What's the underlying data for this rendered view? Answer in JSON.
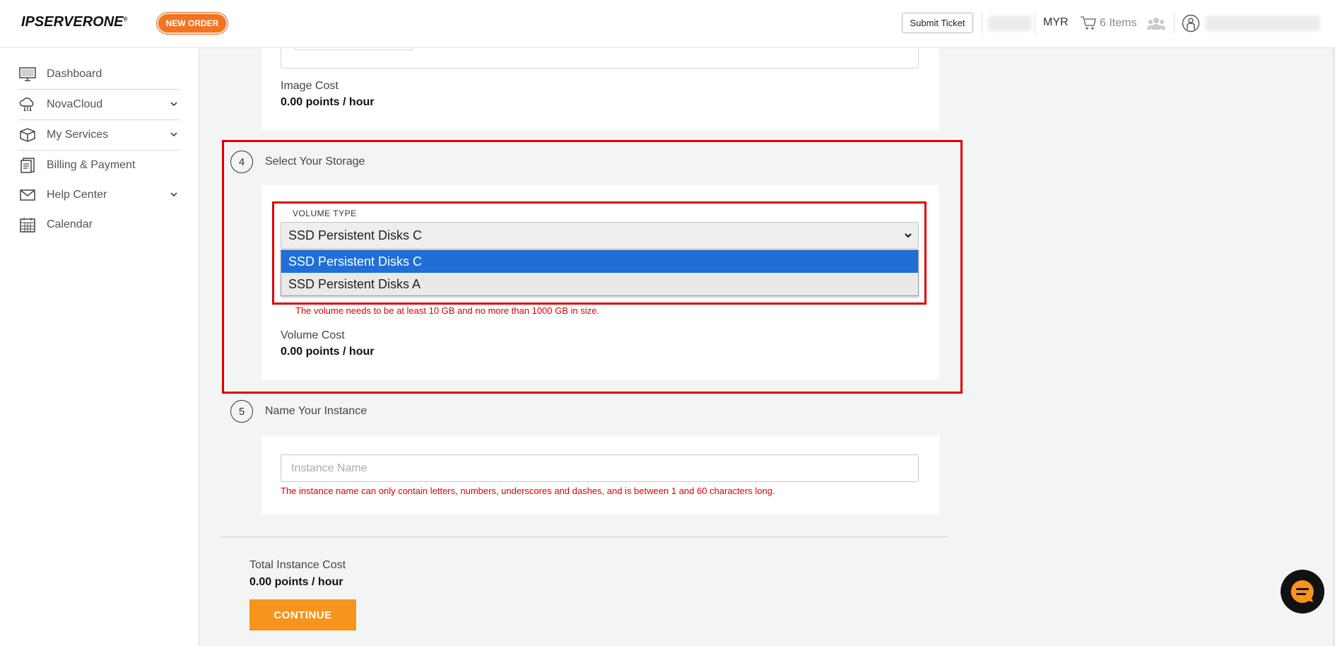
{
  "header": {
    "logo": "IPSERVERONE",
    "logo_mark": "®",
    "new_order": "NEW ORDER",
    "submit_ticket": "Submit Ticket",
    "currency": "MYR",
    "cart_label": "6 Items",
    "icons": [
      "cart-icon",
      "users-icon",
      "account-icon"
    ]
  },
  "sidebar": {
    "items": [
      {
        "label": "Dashboard",
        "icon": "monitor-icon",
        "expandable": false
      },
      {
        "label": "NovaCloud",
        "icon": "cloud-icon",
        "expandable": true
      },
      {
        "label": "My Services",
        "icon": "box-icon",
        "expandable": true
      },
      {
        "label": "Billing & Payment",
        "icon": "invoice-icon",
        "expandable": false
      },
      {
        "label": "Help Center",
        "icon": "envelope-icon",
        "expandable": true
      },
      {
        "label": "Calendar",
        "icon": "calendar-icon",
        "expandable": false
      }
    ]
  },
  "image_section": {
    "cost_label": "Image Cost",
    "cost_value": "0.00 points / hour"
  },
  "storage_section": {
    "step_number": "4",
    "title": "Select Your Storage",
    "volume_type_label": "VOLUME TYPE",
    "selected": "SSD Persistent Disks C",
    "options": [
      "SSD Persistent Disks C",
      "SSD Persistent Disks A"
    ],
    "error": "The volume needs to be at least 10 GB and no more than 1000 GB in size.",
    "cost_label": "Volume Cost",
    "cost_value": "0.00 points / hour"
  },
  "name_section": {
    "step_number": "5",
    "title": "Name Your Instance",
    "placeholder": "Instance Name",
    "error": "The instance name can only contain letters, numbers, underscores and dashes, and is between 1 and 60 characters long."
  },
  "total": {
    "label": "Total Instance Cost",
    "value": "0.00 points / hour",
    "continue": "CONTINUE"
  },
  "colors": {
    "accent_orange": "#f7941d",
    "new_order_orange": "#f47321",
    "highlight_red": "#e00000",
    "selected_blue": "#1f6fd6",
    "error_red": "#dd0000"
  }
}
